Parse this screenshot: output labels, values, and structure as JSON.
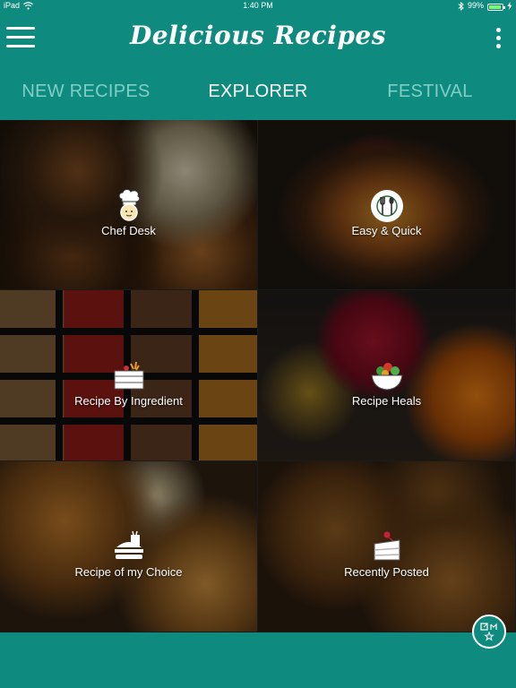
{
  "status_bar": {
    "device": "iPad",
    "time": "1:40 PM",
    "battery": "99%",
    "battery_level": 0.99
  },
  "header": {
    "title": "Delicious Recipes"
  },
  "tabs": [
    {
      "label": "NEW RECIPES",
      "active": false
    },
    {
      "label": "EXPLORER",
      "active": true
    },
    {
      "label": "FESTIVAL",
      "active": false
    }
  ],
  "tiles": [
    {
      "label": "Chef Desk",
      "icon": "chef-hat-icon"
    },
    {
      "label": "Easy & Quick",
      "icon": "plate-fork-spoon-icon"
    },
    {
      "label": "Recipe By Ingredient",
      "icon": "ingredients-box-icon"
    },
    {
      "label": "Recipe Heals",
      "icon": "salad-bowl-icon"
    },
    {
      "label": "Recipe of my Choice",
      "icon": "fast-food-icon"
    },
    {
      "label": "Recently Posted",
      "icon": "cake-slice-icon"
    }
  ],
  "colors": {
    "primary": "#0f8a7e",
    "tab_inactive": "#7fcfc6",
    "tab_active": "#ffffff"
  }
}
